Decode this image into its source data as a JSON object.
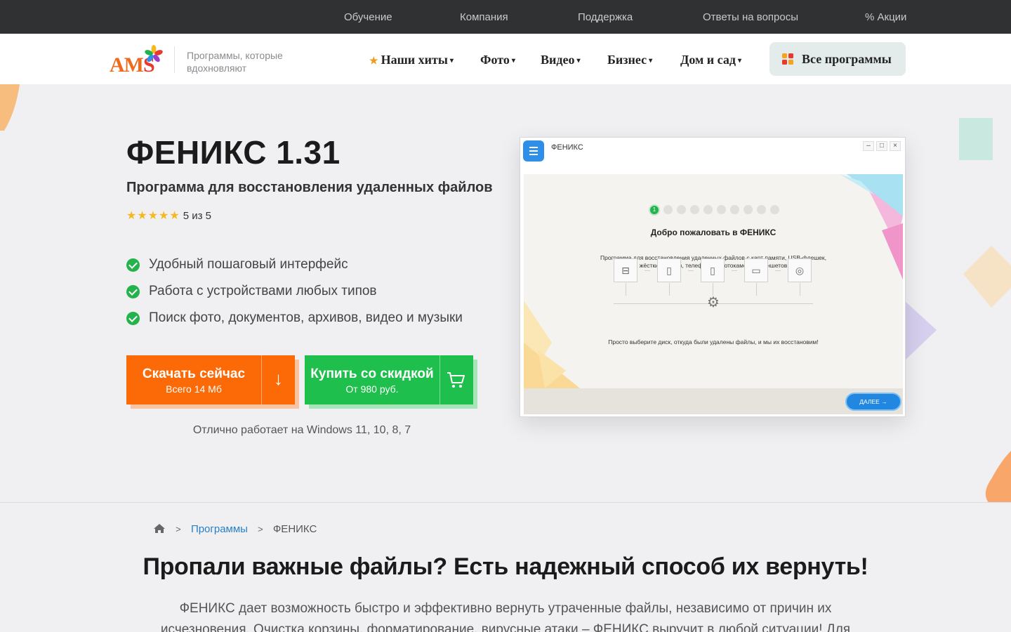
{
  "topnav": {
    "items": [
      "Обучение",
      "Компания",
      "Поддержка",
      "Ответы на вопросы"
    ],
    "promo_icon": "%",
    "promo": "Акции"
  },
  "header": {
    "logo": {
      "text_main": "AM",
      "text_s": "S"
    },
    "tagline": "Программы, которые вдохновляют",
    "nav": [
      {
        "label": "Наши хиты",
        "icon": "star-icon"
      },
      {
        "label": "Фото"
      },
      {
        "label": "Видео"
      },
      {
        "label": "Бизнес"
      },
      {
        "label": "Дом и сад"
      }
    ],
    "all_programs": "Все программы"
  },
  "hero": {
    "title": "ФЕНИКС 1.31",
    "subtitle": "Программа для восстановления удаленных файлов",
    "rating_stars": "★★★★★",
    "rating_text": "5 из 5",
    "rating_value": 5,
    "features": [
      "Удобный пошаговый интерфейс",
      "Работа с устройствами любых типов",
      "Поиск фото, документов, архивов, видео и музыки"
    ],
    "download": {
      "title": "Скачать сейчас",
      "sub": "Всего 14 Мб",
      "icon": "↓"
    },
    "buy": {
      "title": "Купить со скидкой",
      "sub": "От 980 руб.",
      "icon": "cart-icon"
    },
    "os_note": "Отлично работает на Windows 11, 10, 8, 7"
  },
  "app_window": {
    "title": "ФЕНИКС",
    "step_active": "1",
    "heading": "Добро пожаловать в ФЕНИКС",
    "description": "Программа для восстановления удаленных файлов с карт памяти, USB-флешек, жёстких дисков, телефонов, фотокамер и планшетов",
    "hint": "Просто выберите диск, откуда были удалены файлы, и мы их восстановим!",
    "next": "ДАЛЕЕ →",
    "controls": [
      "–",
      "□",
      "×"
    ]
  },
  "breadcrumb": {
    "items": [
      "Программы",
      "ФЕНИКС"
    ],
    "separator": ">"
  },
  "section": {
    "title": "Пропали важные файлы? Есть надежный способ их вернуть!",
    "text": "ФЕНИКС дает возможность быстро и эффективно вернуть утраченные файлы, независимо от причин их исчезновения. Очистка корзины, форматирование, вирусные атаки – ФЕНИКС выручит в любой ситуации! Для"
  },
  "colors": {
    "orange": "#fb6a06",
    "green": "#1ebf4c",
    "topbar": "#303133",
    "link": "#2a7fc4"
  }
}
